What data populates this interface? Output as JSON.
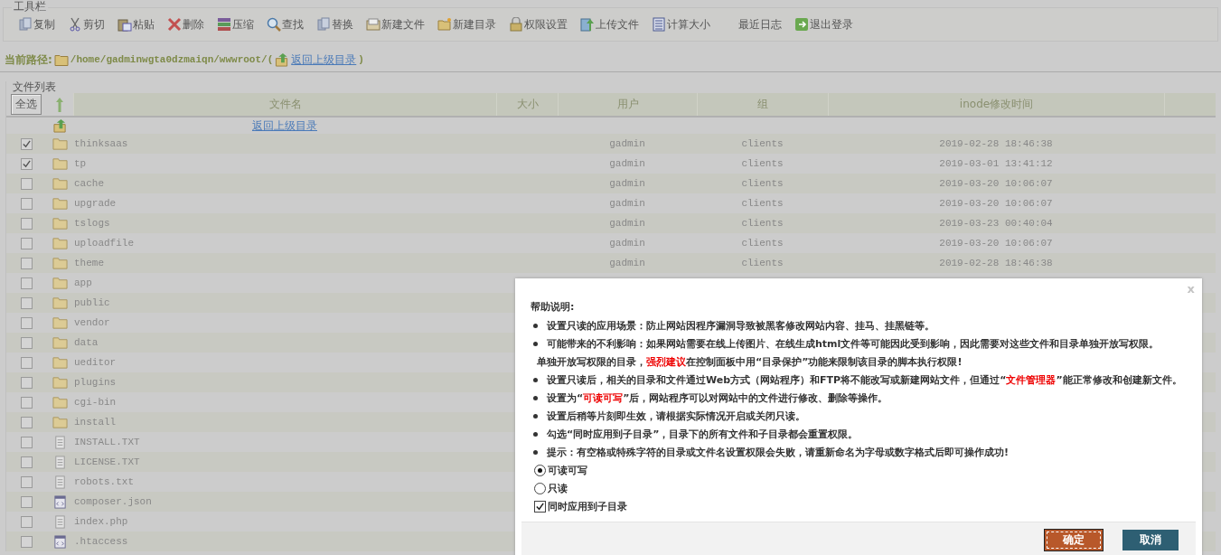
{
  "toolbar": {
    "legend": "工具栏",
    "buttons": [
      {
        "label": "复制",
        "kind": "copy"
      },
      {
        "label": "剪切",
        "kind": "cut"
      },
      {
        "label": "粘贴",
        "kind": "paste"
      },
      {
        "label": "删除",
        "kind": "delete"
      },
      {
        "label": "压缩",
        "kind": "compress"
      },
      {
        "label": "查找",
        "kind": "search"
      },
      {
        "label": "替换",
        "kind": "copy"
      },
      {
        "label": "新建文件",
        "kind": "newfile"
      },
      {
        "label": "新建目录",
        "kind": "newfolder"
      },
      {
        "label": "权限设置",
        "kind": "lock"
      },
      {
        "label": "上传文件",
        "kind": "upload"
      },
      {
        "label": "计算大小",
        "kind": "calc"
      },
      {
        "label": "最近日志",
        "kind": "none"
      },
      {
        "label": "退出登录",
        "kind": "logout"
      }
    ]
  },
  "path": {
    "label": "当前路径:",
    "value": "/home/gadminwgta0dzmaiqn/wwwroot/",
    "open": "(",
    "link": "返回上级目录",
    "close": ")"
  },
  "file_list": {
    "legend": "文件列表",
    "select_all": "全选",
    "columns": [
      "文件名",
      "大小",
      "用户",
      "组",
      "inode修改时间"
    ],
    "up_link": "返回上级目录",
    "rows": [
      {
        "checked": true,
        "kind": "folder",
        "name": "thinksaas",
        "user": "gadmin",
        "group": "clients",
        "modified": "2019-02-28 18:46:38"
      },
      {
        "checked": true,
        "kind": "folder",
        "name": "tp",
        "user": "gadmin",
        "group": "clients",
        "modified": "2019-03-01 13:41:12"
      },
      {
        "checked": false,
        "kind": "folder",
        "name": "cache",
        "user": "gadmin",
        "group": "clients",
        "modified": "2019-03-20 10:06:07"
      },
      {
        "checked": false,
        "kind": "folder",
        "name": "upgrade",
        "user": "gadmin",
        "group": "clients",
        "modified": "2019-03-20 10:06:07"
      },
      {
        "checked": false,
        "kind": "folder",
        "name": "tslogs",
        "user": "gadmin",
        "group": "clients",
        "modified": "2019-03-23 00:40:04"
      },
      {
        "checked": false,
        "kind": "folder",
        "name": "uploadfile",
        "user": "gadmin",
        "group": "clients",
        "modified": "2019-03-20 10:06:07"
      },
      {
        "checked": false,
        "kind": "folder",
        "name": "theme",
        "user": "gadmin",
        "group": "clients",
        "modified": "2019-02-28 18:46:38"
      },
      {
        "checked": false,
        "kind": "folder",
        "name": "app"
      },
      {
        "checked": false,
        "kind": "folder",
        "name": "public"
      },
      {
        "checked": false,
        "kind": "folder",
        "name": "vendor"
      },
      {
        "checked": false,
        "kind": "folder",
        "name": "data"
      },
      {
        "checked": false,
        "kind": "folder",
        "name": "ueditor"
      },
      {
        "checked": false,
        "kind": "folder",
        "name": "plugins"
      },
      {
        "checked": false,
        "kind": "folder",
        "name": "cgi-bin"
      },
      {
        "checked": false,
        "kind": "folder",
        "name": "install"
      },
      {
        "checked": false,
        "kind": "text",
        "name": "INSTALL.TXT"
      },
      {
        "checked": false,
        "kind": "text",
        "name": "LICENSE.TXT"
      },
      {
        "checked": false,
        "kind": "text",
        "name": "robots.txt"
      },
      {
        "checked": false,
        "kind": "code",
        "name": "composer.json"
      },
      {
        "checked": false,
        "kind": "text",
        "name": "index.php"
      },
      {
        "checked": false,
        "kind": "code",
        "name": ".htaccess"
      }
    ]
  },
  "dialog": {
    "close": "x",
    "title": "帮助说明:",
    "items": [
      {
        "kind": "bullet",
        "text": "设置只读的应用场景：防止网站因程序漏洞导致被黑客修改网站内容、挂马、挂黑链等。"
      },
      {
        "kind": "bullet",
        "text": "可能带来的不利影响：如果网站需要在线上传图片、在线生成html文件等可能因此受到影响，因此需要对这些文件和目录单独开放写权限。"
      },
      {
        "kind": "note",
        "text": "单独开放写权限的目录，**强烈建议**在控制面板中用“目录保护”功能来限制该目录的脚本执行权限!"
      },
      {
        "kind": "bullet",
        "text": "设置只读后，相关的目录和文件通过Web方式（网站程序）和FTP将不能改写或新建网站文件，但通过“**文件管理器**”能正常修改和创建新文件。"
      },
      {
        "kind": "bullet",
        "text": "设置为“**可读可写**”后，网站程序可以对网站中的文件进行修改、删除等操作。"
      },
      {
        "kind": "bullet",
        "text": "设置后稍等片刻即生效，请根据实际情况开启或关闭只读。"
      },
      {
        "kind": "bullet",
        "text": "勾选“同时应用到子目录”，目录下的所有文件和子目录都会重置权限。"
      },
      {
        "kind": "bullet",
        "text": "提示：有空格或特殊字符的目录或文件名设置权限会失败，请重新命名为字母或数字格式后即可操作成功!"
      }
    ],
    "options": [
      {
        "kind": "radio",
        "label": "可读可写",
        "selected": true
      },
      {
        "kind": "radio",
        "label": "只读",
        "selected": false
      },
      {
        "kind": "checkbox",
        "label": "同时应用到子目录",
        "checked": true
      }
    ],
    "buttons": [
      {
        "label": "确定",
        "kind": "primary"
      },
      {
        "label": "取消",
        "kind": "secondary"
      }
    ]
  }
}
